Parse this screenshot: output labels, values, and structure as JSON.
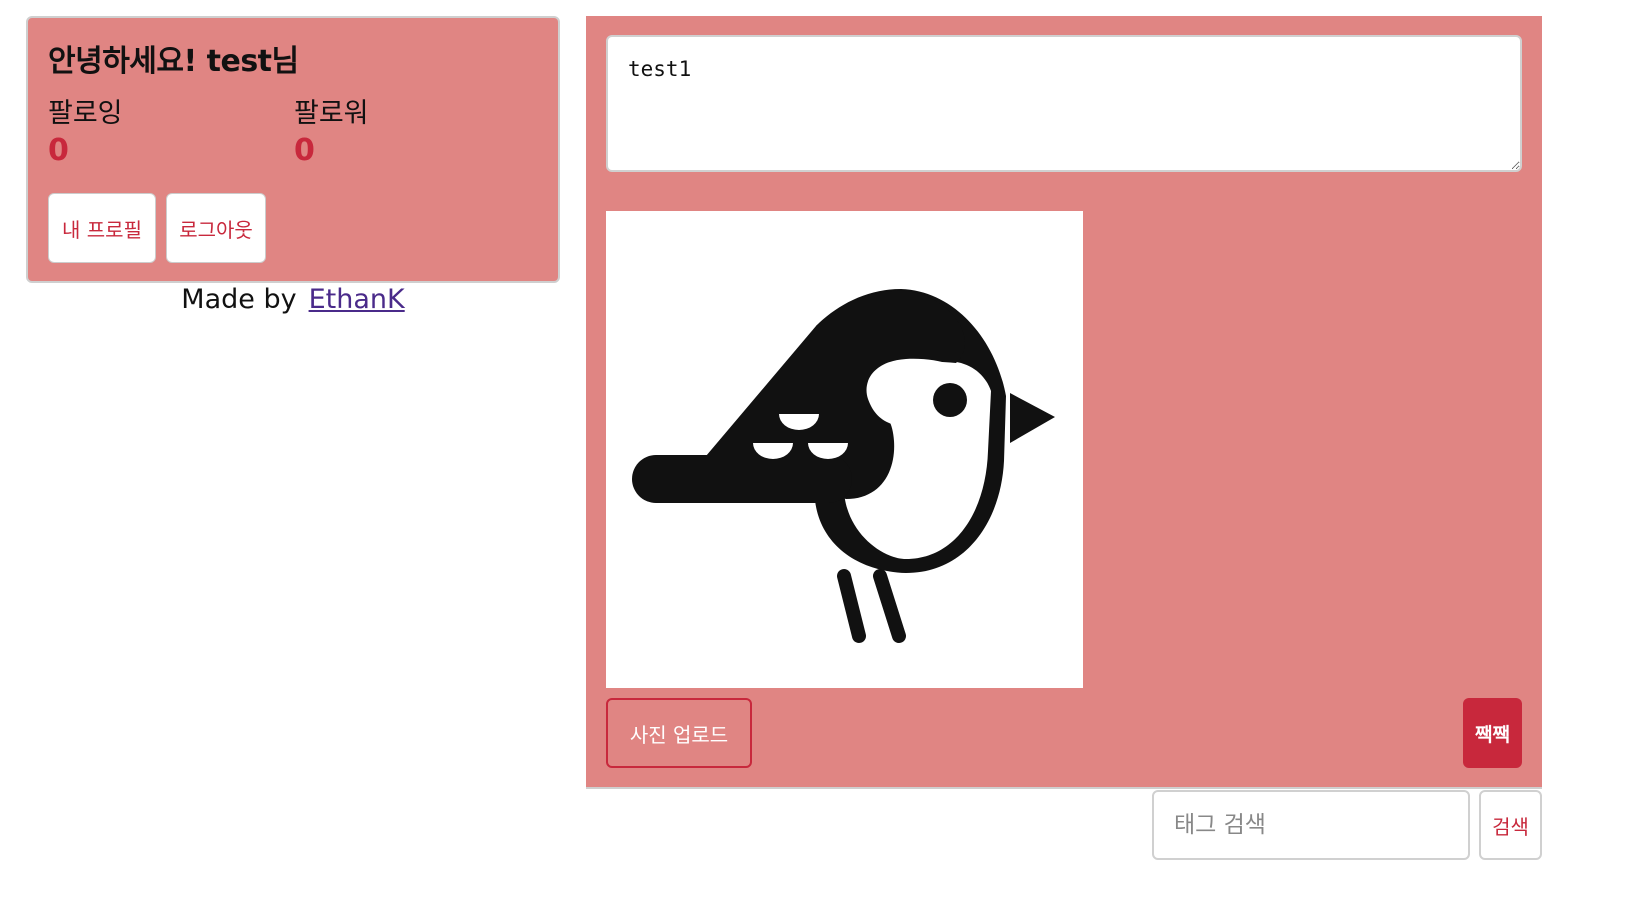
{
  "profile": {
    "greeting": "안녕하세요! test님",
    "following_label": "팔로잉",
    "following_count": "0",
    "follower_label": "팔로워",
    "follower_count": "0",
    "my_profile_label": "내 프로필",
    "logout_label": "로그아웃"
  },
  "footer": {
    "made_by": "Made by",
    "author": "EthanK"
  },
  "tweet_form": {
    "text_value": "test1",
    "preview_image": "bird-icon",
    "upload_label": "사진 업로드",
    "submit_label": "짹짹"
  },
  "search": {
    "placeholder": "태그 검색",
    "button_label": "검색"
  },
  "colors": {
    "accent": "#c8283c",
    "panel": "#e08583"
  }
}
